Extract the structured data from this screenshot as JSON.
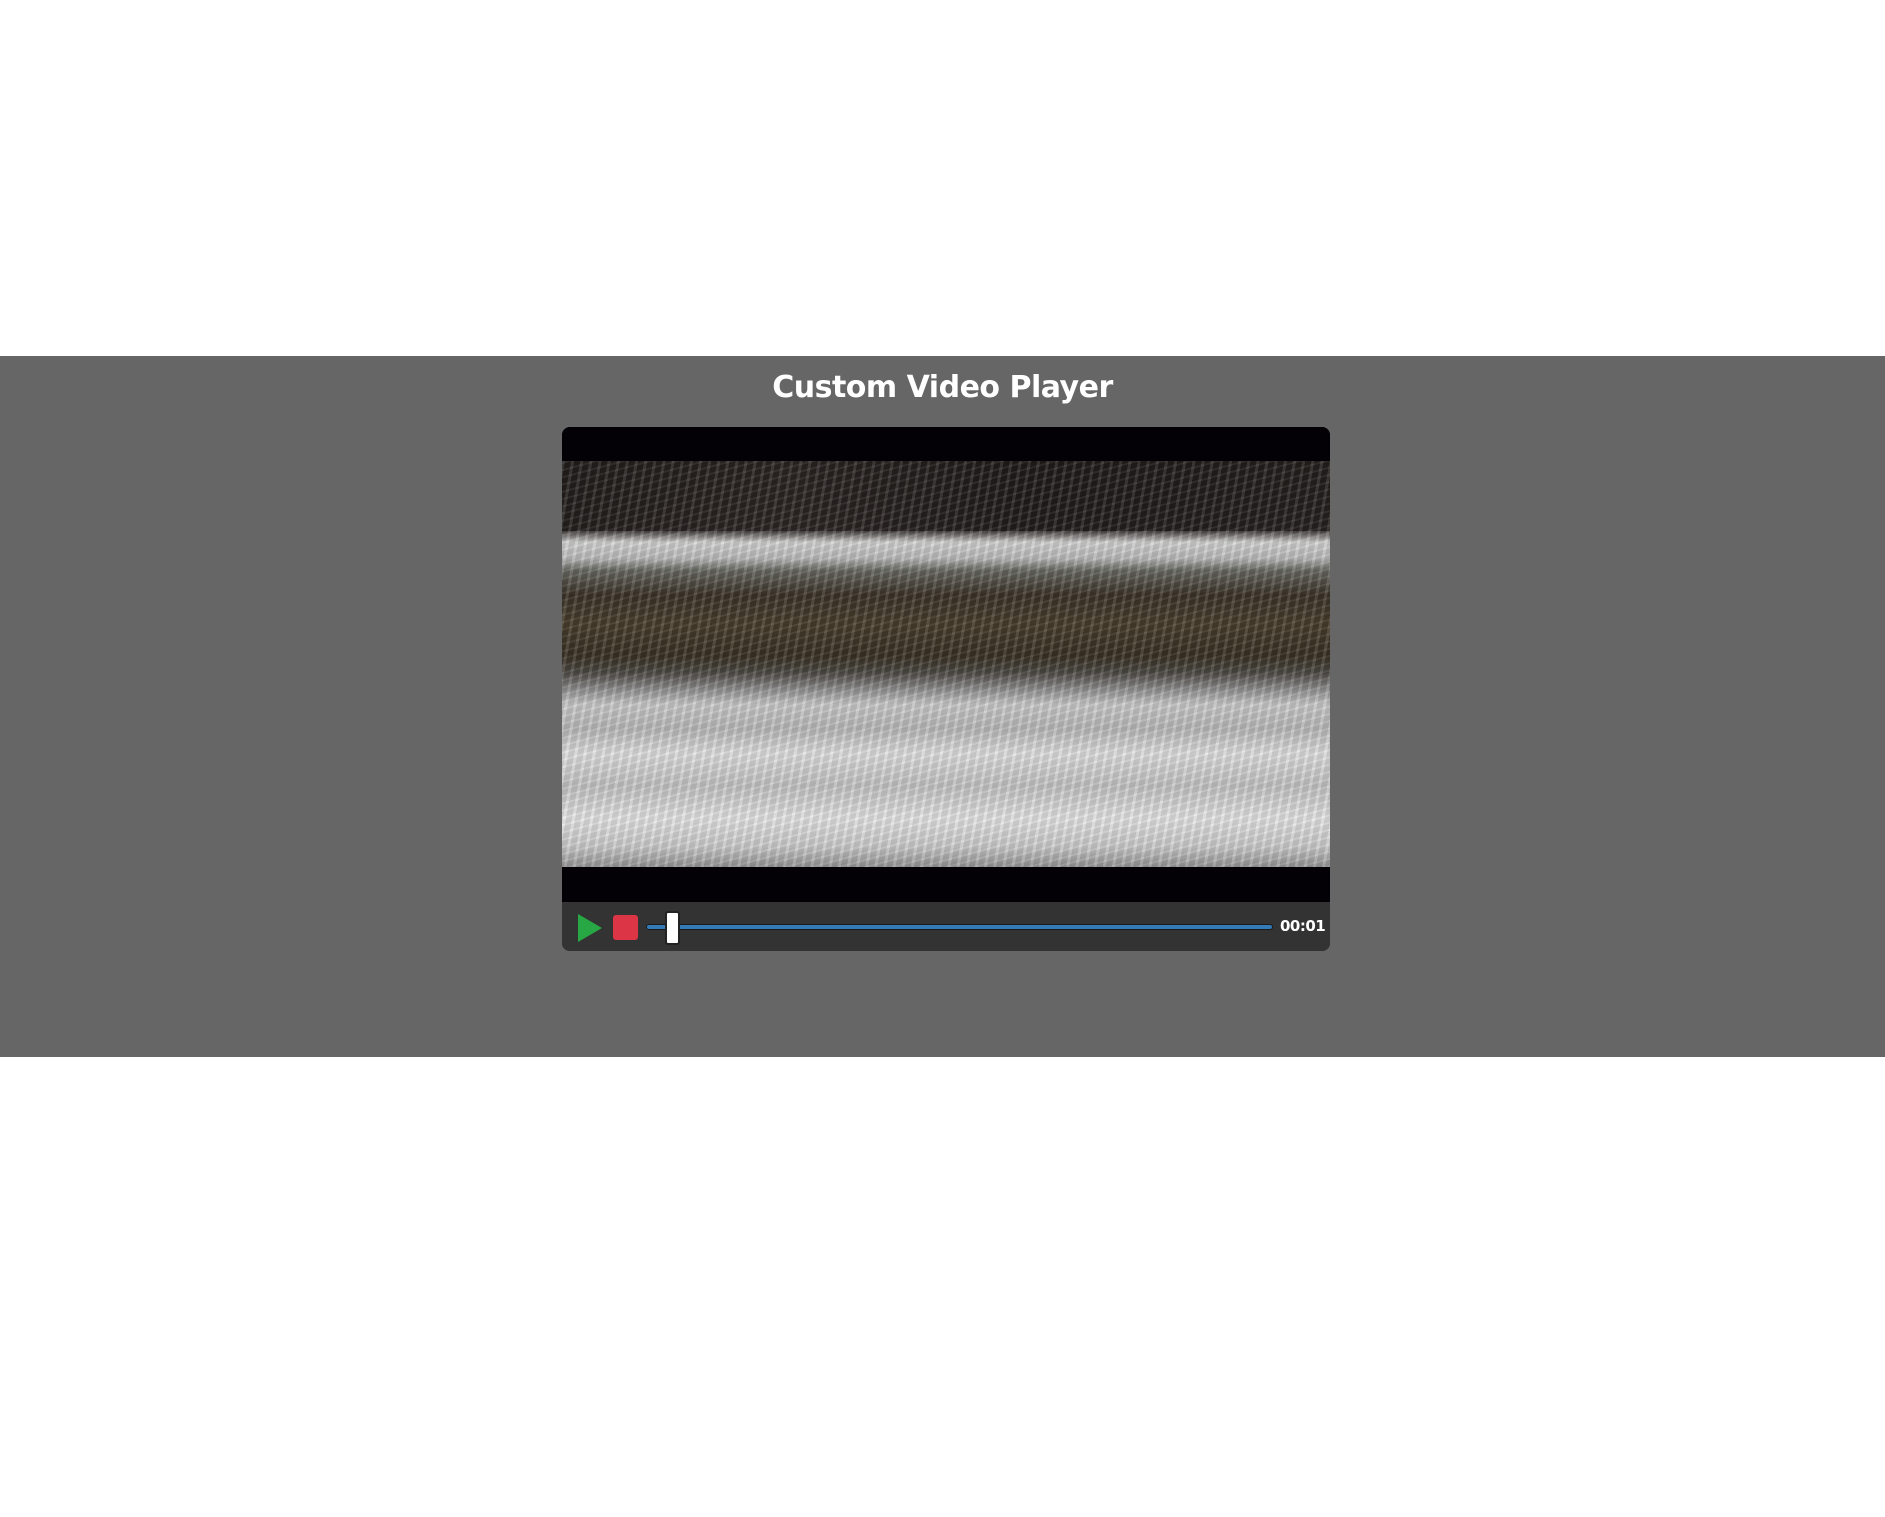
{
  "page": {
    "title": "Custom Video Player"
  },
  "player": {
    "play_icon": "play-icon",
    "stop_icon": "stop-icon",
    "current_time": "00:01",
    "progress_fraction": 0.04,
    "colors": {
      "play": "#28a745",
      "stop": "#dc3545",
      "progress": "#337ab7",
      "controls_bg": "#333333",
      "band_bg": "#666666"
    }
  }
}
